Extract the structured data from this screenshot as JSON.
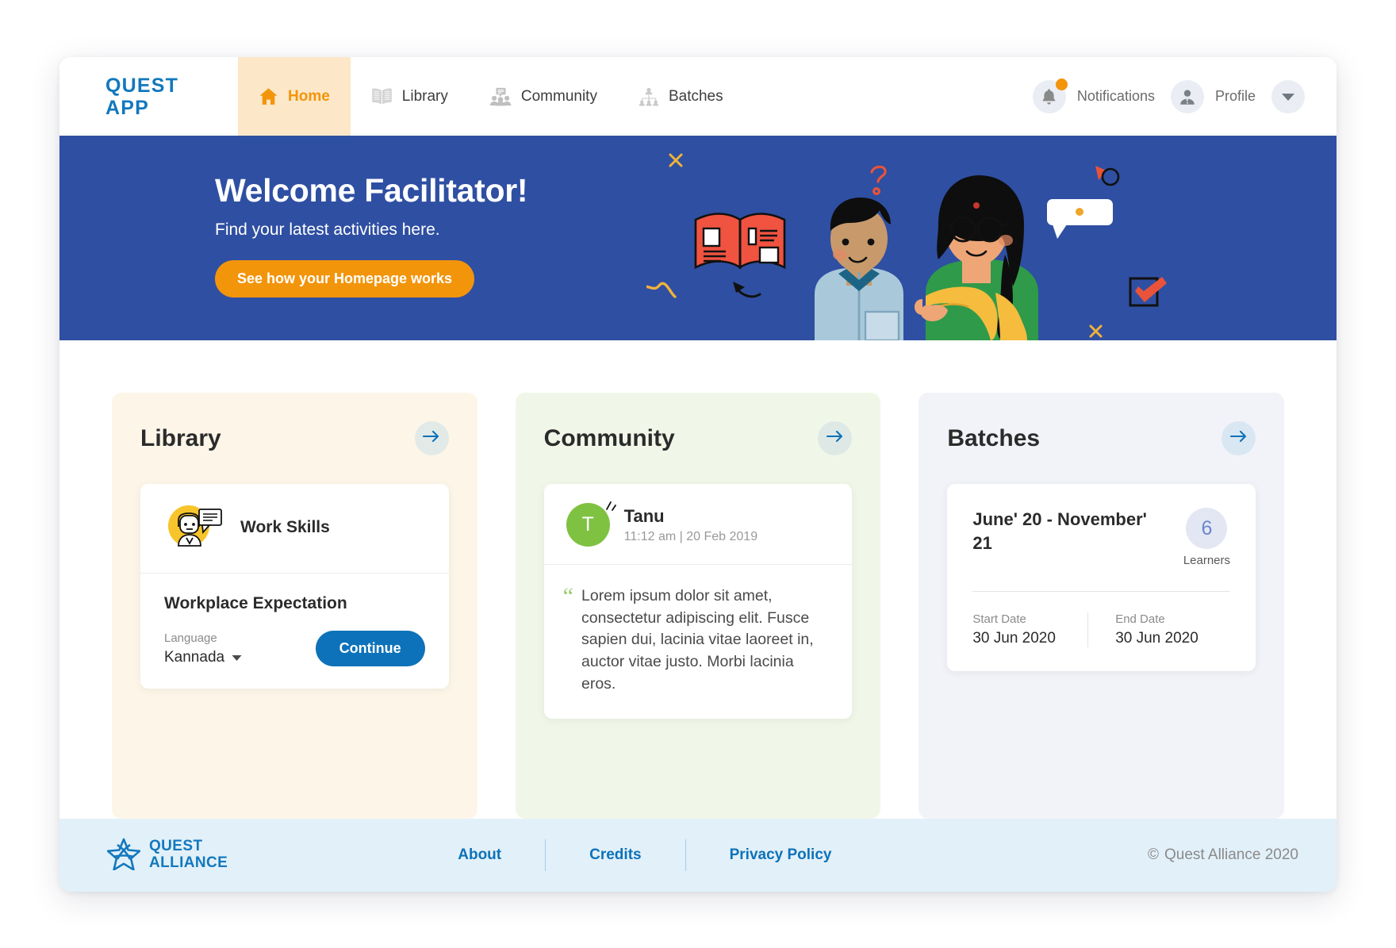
{
  "header": {
    "logo_line1": "QUEST",
    "logo_line2": "APP",
    "nav": [
      {
        "label": "Home",
        "icon": "home-icon",
        "active": true
      },
      {
        "label": "Library",
        "icon": "book-icon",
        "active": false
      },
      {
        "label": "Community",
        "icon": "community-icon",
        "active": false
      },
      {
        "label": "Batches",
        "icon": "batches-icon",
        "active": false
      }
    ],
    "notifications_label": "Notifications",
    "profile_label": "Profile",
    "has_notification_badge": true
  },
  "hero": {
    "title": "Welcome Facilitator!",
    "subtitle": "Find your latest activities here.",
    "button_label": "See how your Homepage works",
    "background_color": "#2F4FA2",
    "button_color": "#F2950B"
  },
  "cards": {
    "library": {
      "title": "Library",
      "background_color": "#FDF6E8",
      "course_name": "Work Skills",
      "module_title": "Workplace Expectation",
      "language_label": "Language",
      "language_value": "Kannada",
      "continue_label": "Continue",
      "continue_color": "#0D72B9"
    },
    "community": {
      "title": "Community",
      "background_color": "#F1F7E8",
      "author_initial": "T",
      "author_name": "Tanu",
      "timestamp": "11:12 am | 20 Feb 2019",
      "post_text": "Lorem ipsum dolor sit amet, consectetur adipiscing elit. Fusce sapien dui, lacinia vitae laoreet in, auctor vitae justo. Morbi lacinia eros.",
      "avatar_color": "#7FC242"
    },
    "batches": {
      "title": "Batches",
      "background_color": "#F2F3F8",
      "date_range": "June' 20 - November' 21",
      "learners_count": "6",
      "learners_label": "Learners",
      "start_date_label": "Start Date",
      "start_date_value": "30 Jun 2020",
      "end_date_label": "End Date",
      "end_date_value": "30 Jun 2020"
    }
  },
  "footer": {
    "logo_line1": "QUEST",
    "logo_line2": "ALLIANCE",
    "links": [
      "About",
      "Credits",
      "Privacy Policy"
    ],
    "copyright_symbol": "©",
    "copyright_text": "Quest Alliance 2020",
    "background_color": "#E2F0F9"
  }
}
